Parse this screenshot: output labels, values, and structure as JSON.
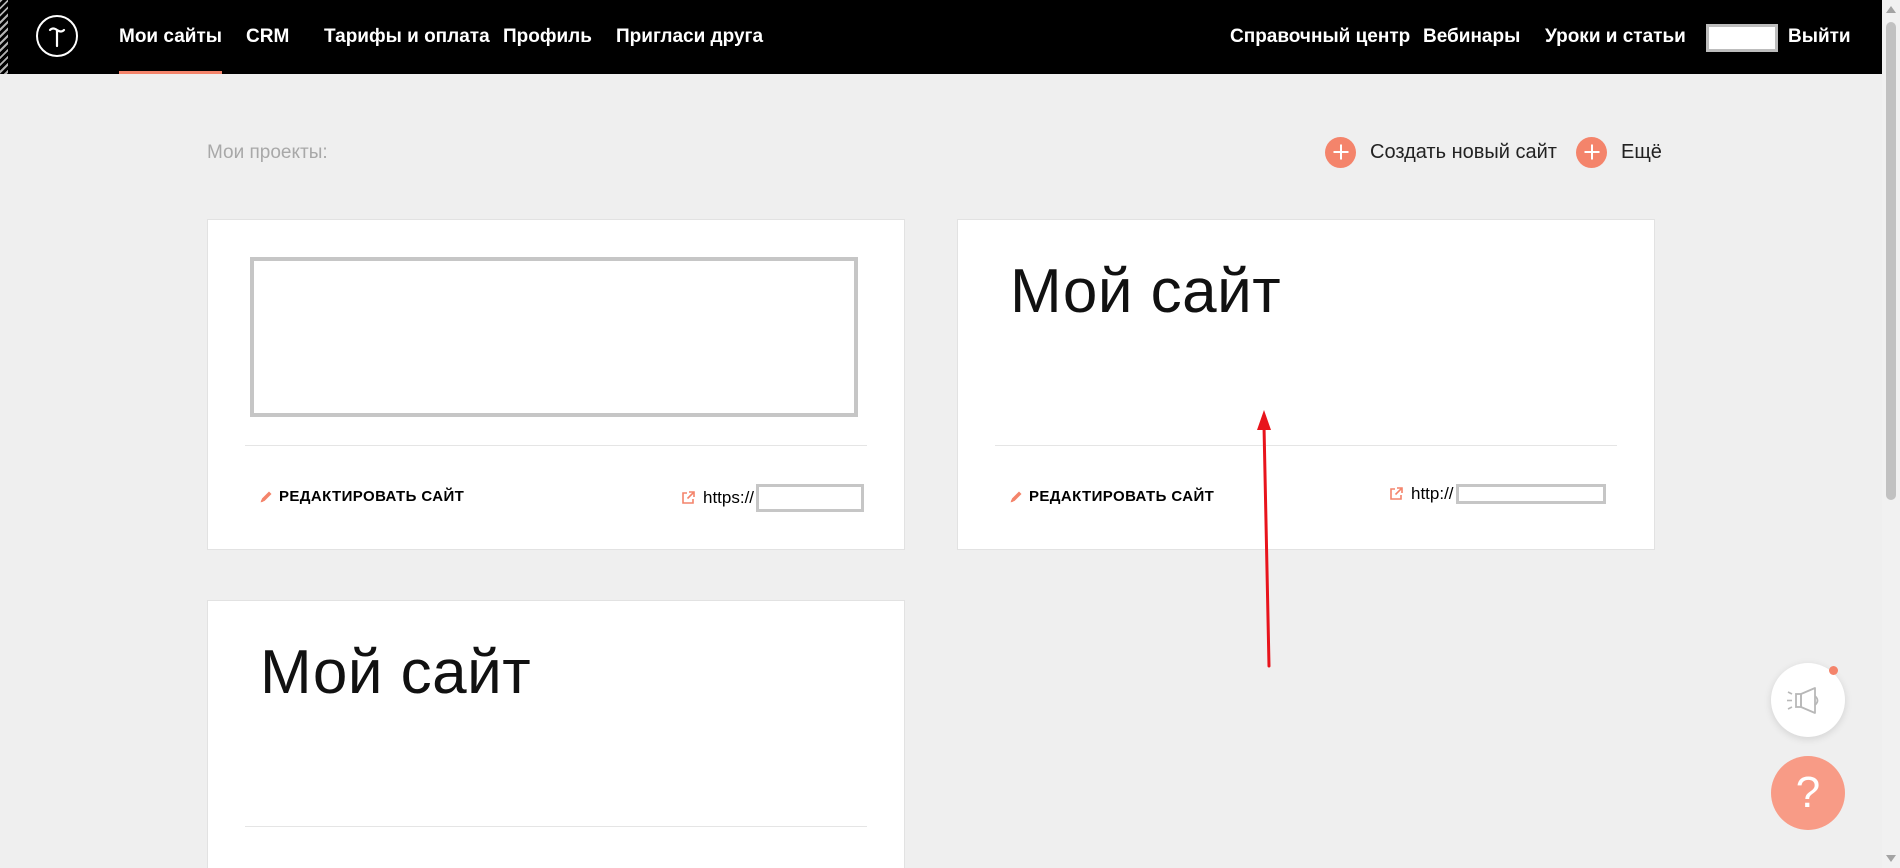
{
  "nav": {
    "left_items": [
      "Мои сайты",
      "CRM",
      "Тарифы и оплата",
      "Профиль",
      "Пригласи друга"
    ],
    "right_items": [
      "Справочный центр",
      "Вебинары",
      "Уроки и статьи"
    ],
    "logout": "Выйти"
  },
  "projects": {
    "title": "Мои проекты:",
    "create_label": "Создать новый сайт",
    "more_label": "Ещё"
  },
  "cards": [
    {
      "title": "",
      "edit_label": "РЕДАКТИРОВАТЬ САЙТ",
      "url_prefix": "https://"
    },
    {
      "title": "Мой сайт",
      "edit_label": "РЕДАКТИРОВАТЬ САЙТ",
      "url_prefix": "http://"
    },
    {
      "title": "Мой сайт"
    }
  ],
  "help": {
    "symbol": "?"
  },
  "colors": {
    "accent": "#f4846b",
    "topbar": "#000000",
    "page_bg": "#efefef",
    "annotation_arrow": "#e8141c"
  }
}
